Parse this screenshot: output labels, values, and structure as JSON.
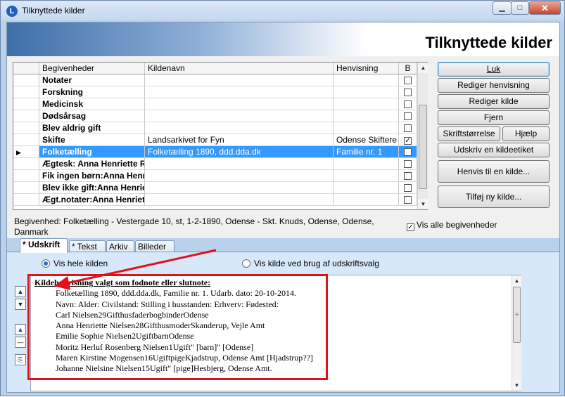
{
  "window": {
    "title": "Tilknyttede kilder",
    "app_icon_letter": "L",
    "minimize": "▁",
    "maximize": "□",
    "close": "✕"
  },
  "header": {
    "title": "Tilknyttede kilder"
  },
  "grid": {
    "columns": [
      "Begivenheder",
      "Kildenavn",
      "Henvisning",
      "B"
    ],
    "rows": [
      {
        "event": "Notater",
        "source": "",
        "ref": "",
        "checked": false,
        "selected": false
      },
      {
        "event": "Forskning",
        "source": "",
        "ref": "",
        "checked": false,
        "selected": false
      },
      {
        "event": "Medicinsk",
        "source": "",
        "ref": "",
        "checked": false,
        "selected": false
      },
      {
        "event": "Dødsårsag",
        "source": "",
        "ref": "",
        "checked": false,
        "selected": false
      },
      {
        "event": "Blev aldrig gift",
        "source": "",
        "ref": "",
        "checked": false,
        "selected": false
      },
      {
        "event": "Skifte",
        "source": "Landsarkivet for Fyn",
        "ref": "Odense Skiftere",
        "checked": true,
        "selected": false
      },
      {
        "event": "Folketælling",
        "source": "Folketælling 1890, ddd.dda.dk",
        "ref": "Familie nr. 1",
        "checked": false,
        "selected": true
      },
      {
        "event": "Ægtesk: Anna Henriette R",
        "source": "",
        "ref": "",
        "checked": false,
        "selected": false
      },
      {
        "event": "Fik ingen børn:Anna Henri",
        "source": "",
        "ref": "",
        "checked": false,
        "selected": false
      },
      {
        "event": "Blev ikke gift:Anna Henriet",
        "source": "",
        "ref": "",
        "checked": false,
        "selected": false
      },
      {
        "event": "Ægt.notater:Anna Henriett",
        "source": "",
        "ref": "",
        "checked": false,
        "selected": false
      }
    ],
    "pointer": "▶",
    "check_mark": "✓"
  },
  "buttons": {
    "close": "Luk",
    "edit_reference": "Rediger henvisning",
    "edit_source": "Rediger kilde",
    "remove": "Fjern",
    "font_size": "Skriftstørrelse",
    "help": "Hjælp",
    "print_label": "Udskriv en kildeetiket",
    "refer_source": "Henvis til en kilde...",
    "add_source": "Tilføj ny kilde..."
  },
  "event_text": "Begivenhed: Folketælling - Vestergade 10, st, 1-2-1890, Odense - Skt. Knuds, Odense, Odense, Danmark",
  "show_all": {
    "label": "Vis alle begivenheder",
    "checked": true
  },
  "tabs": [
    "* Udskrift",
    "* Tekst",
    "Arkiv",
    "Billeder"
  ],
  "panel": {
    "radio_whole": "Vis hele kilden",
    "radio_print": "Vis kilde ved brug af udskriftsvalg",
    "heading": "Kildehenvisning valgt som fodnote eller slutnote:",
    "lines": [
      "Folketælling 1890, ddd.dda.dk, Familie nr. 1.  Udarb. dato: 20-10-2014.",
      "Navn: Alder: Civilstand: Stilling i husstanden: Erhverv: Fødested:",
      "Carl Nielsen29GifthusfaderbogbinderOdense",
      "Anna Henriette Nielsen28GifthusmoderSkanderup, Vejle Amt",
      "Emilie Sophie Nielsen2UgiftbarnOdense",
      "Moritz Herluf Rosenberg Nielsen1Ugift\" [barn]\" [Odense]",
      "Maren Kirstine Mogensen16UgiftpigeKjadstrup, Odense Amt [Hjadstrup??]",
      "Johanne Nielsine Nielsen15Ugift\" [pige]Hesbjerg, Odense Amt."
    ]
  },
  "colors": {
    "selection": "#3399ff",
    "annotation": "#e3101b",
    "panel": "#d7e8fa"
  }
}
